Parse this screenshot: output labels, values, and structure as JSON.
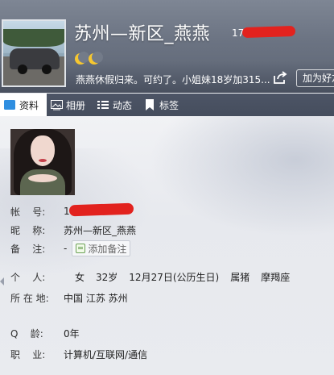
{
  "header": {
    "nickname": "苏州—新区_燕燕",
    "qq_number_prefix": "17",
    "signature": "燕燕休假归来。可约了。小姐妹18岁加315...",
    "add_friend_label": "加为好友",
    "level_icons": [
      "moon-icon",
      "moon-icon"
    ]
  },
  "tabs": [
    {
      "label": "资料",
      "icon": "profile-card-icon",
      "active": true
    },
    {
      "label": "相册",
      "icon": "photo-album-icon",
      "active": false
    },
    {
      "label": "动态",
      "icon": "feed-list-icon",
      "active": false
    },
    {
      "label": "标签",
      "icon": "tag-icon",
      "active": false
    }
  ],
  "profile": {
    "account": {
      "label": "帐    号:",
      "value": "17"
    },
    "nickname": {
      "label": "昵    称:",
      "value": "苏州—新区_燕燕"
    },
    "remark": {
      "label": "备    注:",
      "value": "-",
      "button": "添加备注"
    },
    "personal": {
      "label": "个    人:",
      "gender": "女",
      "age": "32岁",
      "birthday": "12月27日(公历生日)",
      "zodiac": "属猪",
      "constellation": "摩羯座"
    },
    "location": {
      "label": "所 在 地:",
      "value": "中国 江苏 苏州"
    },
    "q_age": {
      "label": "Q    龄:",
      "value": "0年"
    },
    "occupation": {
      "label": "职    业:",
      "value": "计算机/互联网/通信"
    }
  },
  "colors": {
    "redaction": "#e2221e",
    "tab_active_icon": "#2f8ee0",
    "moon": "#f6c730"
  }
}
